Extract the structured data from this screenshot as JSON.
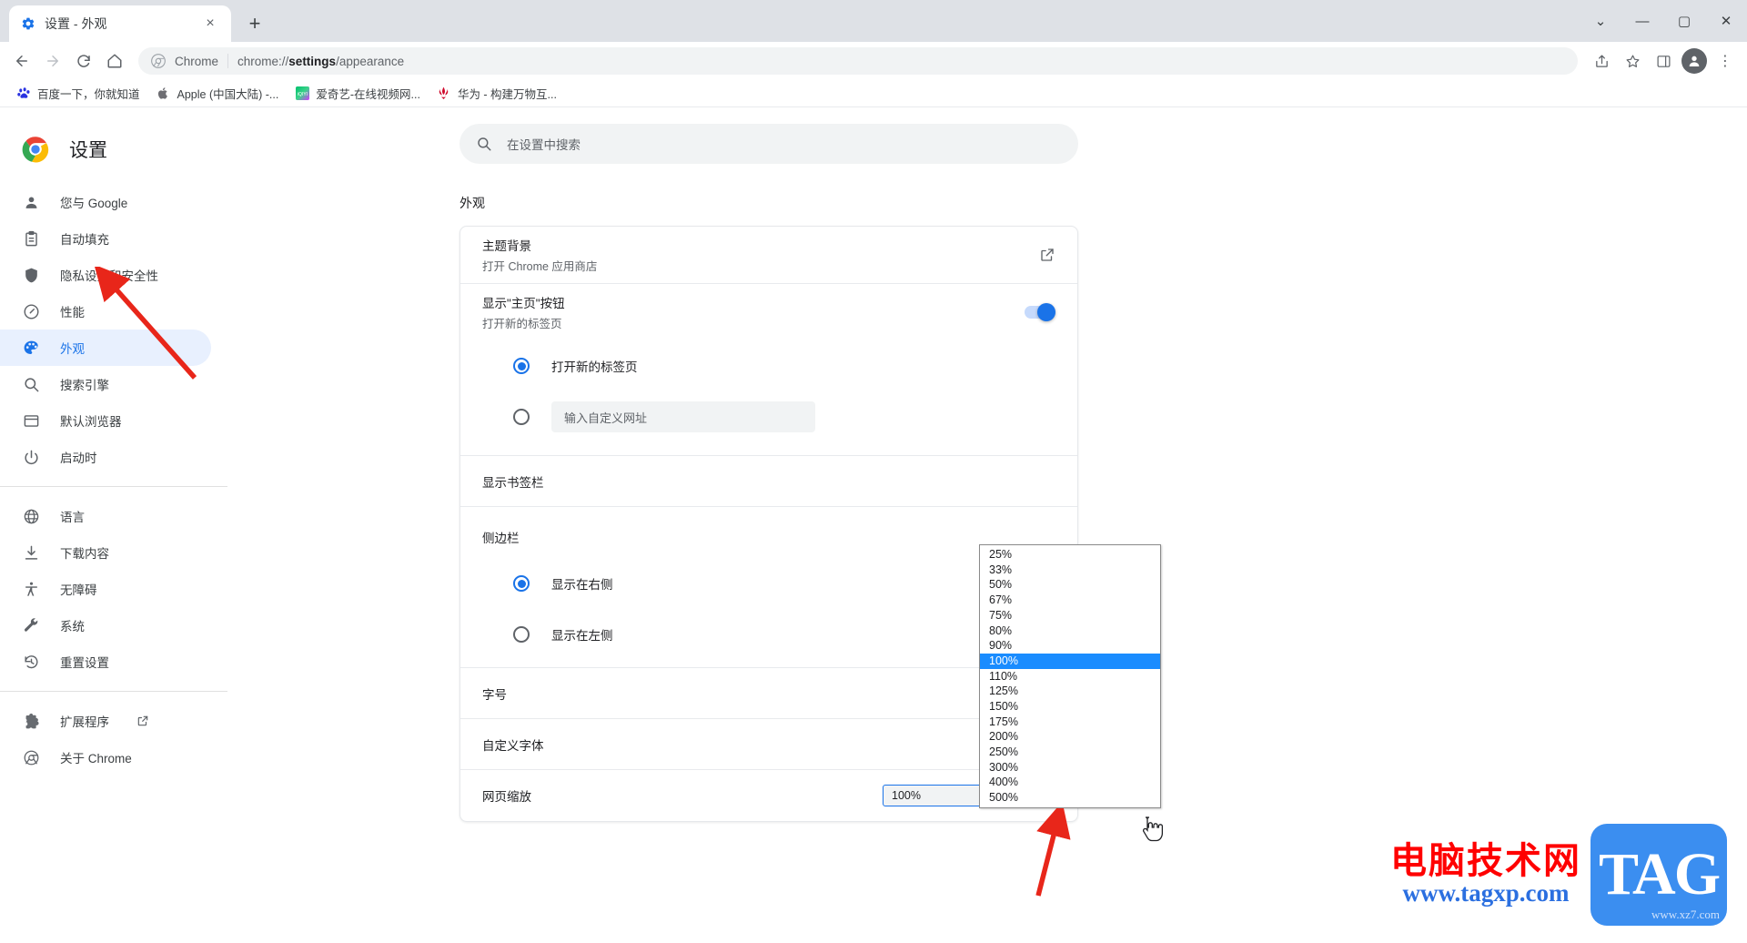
{
  "window": {
    "tab": {
      "title": "设置 - 外观",
      "favicon": "settings-gear-icon",
      "close": "×"
    },
    "new_tab": "+",
    "controls": {
      "minimize_more": "⌄",
      "minimize": "—",
      "maximize": "▢",
      "close": "✕"
    }
  },
  "toolbar": {
    "back": "←",
    "forward": "→",
    "reload": "⟳",
    "home": "⌂",
    "omnibox": {
      "product": "Chrome",
      "url_prefix": "chrome://",
      "url_bold": "settings",
      "url_suffix": "/appearance"
    },
    "share": "share-icon",
    "bookmark": "star-icon",
    "sidepanel": "side-panel-icon",
    "profile": "avatar-icon",
    "menu": "⋮"
  },
  "bookmarks": [
    {
      "label": "百度一下，你就知道",
      "icon": "baidu-icon"
    },
    {
      "label": "Apple (中国大陆) -...",
      "icon": "apple-icon"
    },
    {
      "label": "爱奇艺-在线视频网...",
      "icon": "iqiyi-icon"
    },
    {
      "label": "华为 - 构建万物互...",
      "icon": "huawei-icon"
    }
  ],
  "sidebar": {
    "brand": "设置",
    "groups": [
      {
        "items": [
          {
            "label": "您与 Google",
            "icon": "person-icon",
            "active": false
          },
          {
            "label": "自动填充",
            "icon": "clipboard-icon",
            "active": false
          },
          {
            "label": "隐私设置和安全性",
            "icon": "shield-icon",
            "active": false
          },
          {
            "label": "性能",
            "icon": "speedometer-icon",
            "active": false
          },
          {
            "label": "外观",
            "icon": "palette-icon",
            "active": true
          },
          {
            "label": "搜索引擎",
            "icon": "search-icon",
            "active": false
          },
          {
            "label": "默认浏览器",
            "icon": "browser-window-icon",
            "active": false
          },
          {
            "label": "启动时",
            "icon": "power-icon",
            "active": false
          }
        ]
      },
      {
        "items": [
          {
            "label": "语言",
            "icon": "globe-icon",
            "active": false
          },
          {
            "label": "下载内容",
            "icon": "download-icon",
            "active": false
          },
          {
            "label": "无障碍",
            "icon": "accessibility-icon",
            "active": false
          },
          {
            "label": "系统",
            "icon": "wrench-icon",
            "active": false
          },
          {
            "label": "重置设置",
            "icon": "restore-icon",
            "active": false
          }
        ]
      },
      {
        "items": [
          {
            "label": "扩展程序",
            "icon": "extensions-icon",
            "active": false,
            "external": true
          },
          {
            "label": "关于 Chrome",
            "icon": "chrome-circle-icon",
            "active": false
          }
        ]
      }
    ]
  },
  "search": {
    "placeholder": "在设置中搜索",
    "icon": "search-icon"
  },
  "main": {
    "section_title": "外观",
    "rows": {
      "theme": {
        "title": "主题背景",
        "subtitle": "打开 Chrome 应用商店",
        "action_icon": "open-in-new-icon"
      },
      "home_button": {
        "title": "显示\"主页\"按钮",
        "subtitle": "打开新的标签页",
        "toggle_on": true
      },
      "home_radio": [
        {
          "label": "打开新的标签页",
          "selected": true
        },
        {
          "label": "",
          "selected": false,
          "input_placeholder": "输入自定义网址"
        }
      ],
      "bookmarks_bar": {
        "title": "显示书签栏"
      },
      "side_panel": {
        "title": "侧边栏"
      },
      "side_panel_radio": [
        {
          "label": "显示在右侧",
          "selected": true
        },
        {
          "label": "显示在左侧",
          "selected": false
        }
      ],
      "font_size": {
        "title": "字号"
      },
      "custom_fonts": {
        "title": "自定义字体"
      },
      "page_zoom": {
        "title": "网页缩放",
        "value": "100%"
      }
    }
  },
  "zoom_dropdown": {
    "selected": "100%",
    "options": [
      "25%",
      "33%",
      "50%",
      "67%",
      "75%",
      "80%",
      "90%",
      "100%",
      "110%",
      "125%",
      "150%",
      "175%",
      "200%",
      "250%",
      "300%",
      "400%",
      "500%"
    ]
  },
  "colors": {
    "accent": "#1a73e8",
    "dropdown_highlight": "#1a8cff",
    "annotation_arrow": "#e8261a",
    "tabstrip": "#dee1e6"
  },
  "watermark": {
    "title": "电脑技术网",
    "url": "www.tagxp.com",
    "badge": "TAG",
    "badge_sub": "www.xz7.com"
  }
}
